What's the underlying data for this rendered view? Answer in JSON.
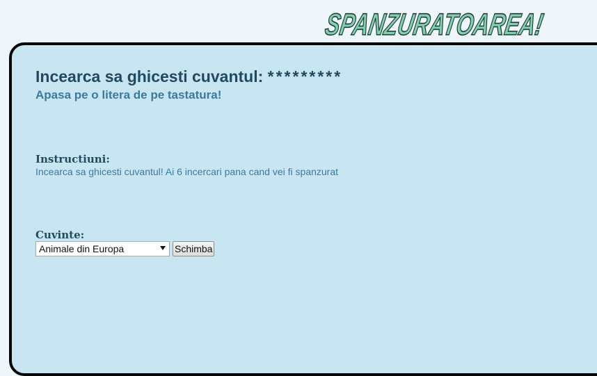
{
  "logo": {
    "text": "Spanzuratoarea!"
  },
  "game": {
    "prompt": "Incearca sa ghicesti cuvantul: ",
    "masked_word": "*********",
    "hint": "Apasa pe o litera de pe tastatura!"
  },
  "instructions": {
    "title": "Instructiuni:",
    "text": "Incearca sa ghicesti cuvantul! Ai 6 incercari pana cand vei fi spanzurat"
  },
  "words": {
    "title": "Cuvinte:",
    "selected_category": "Animale din Europa",
    "change_button": "Schimba"
  },
  "colors": {
    "page_background": "#eef6fc",
    "panel_background": "#c8e6f2",
    "panel_border": "#050505",
    "heading": "#22495f",
    "hint_text": "#3a7a9c",
    "logo_fill": "#7fd1b0"
  }
}
